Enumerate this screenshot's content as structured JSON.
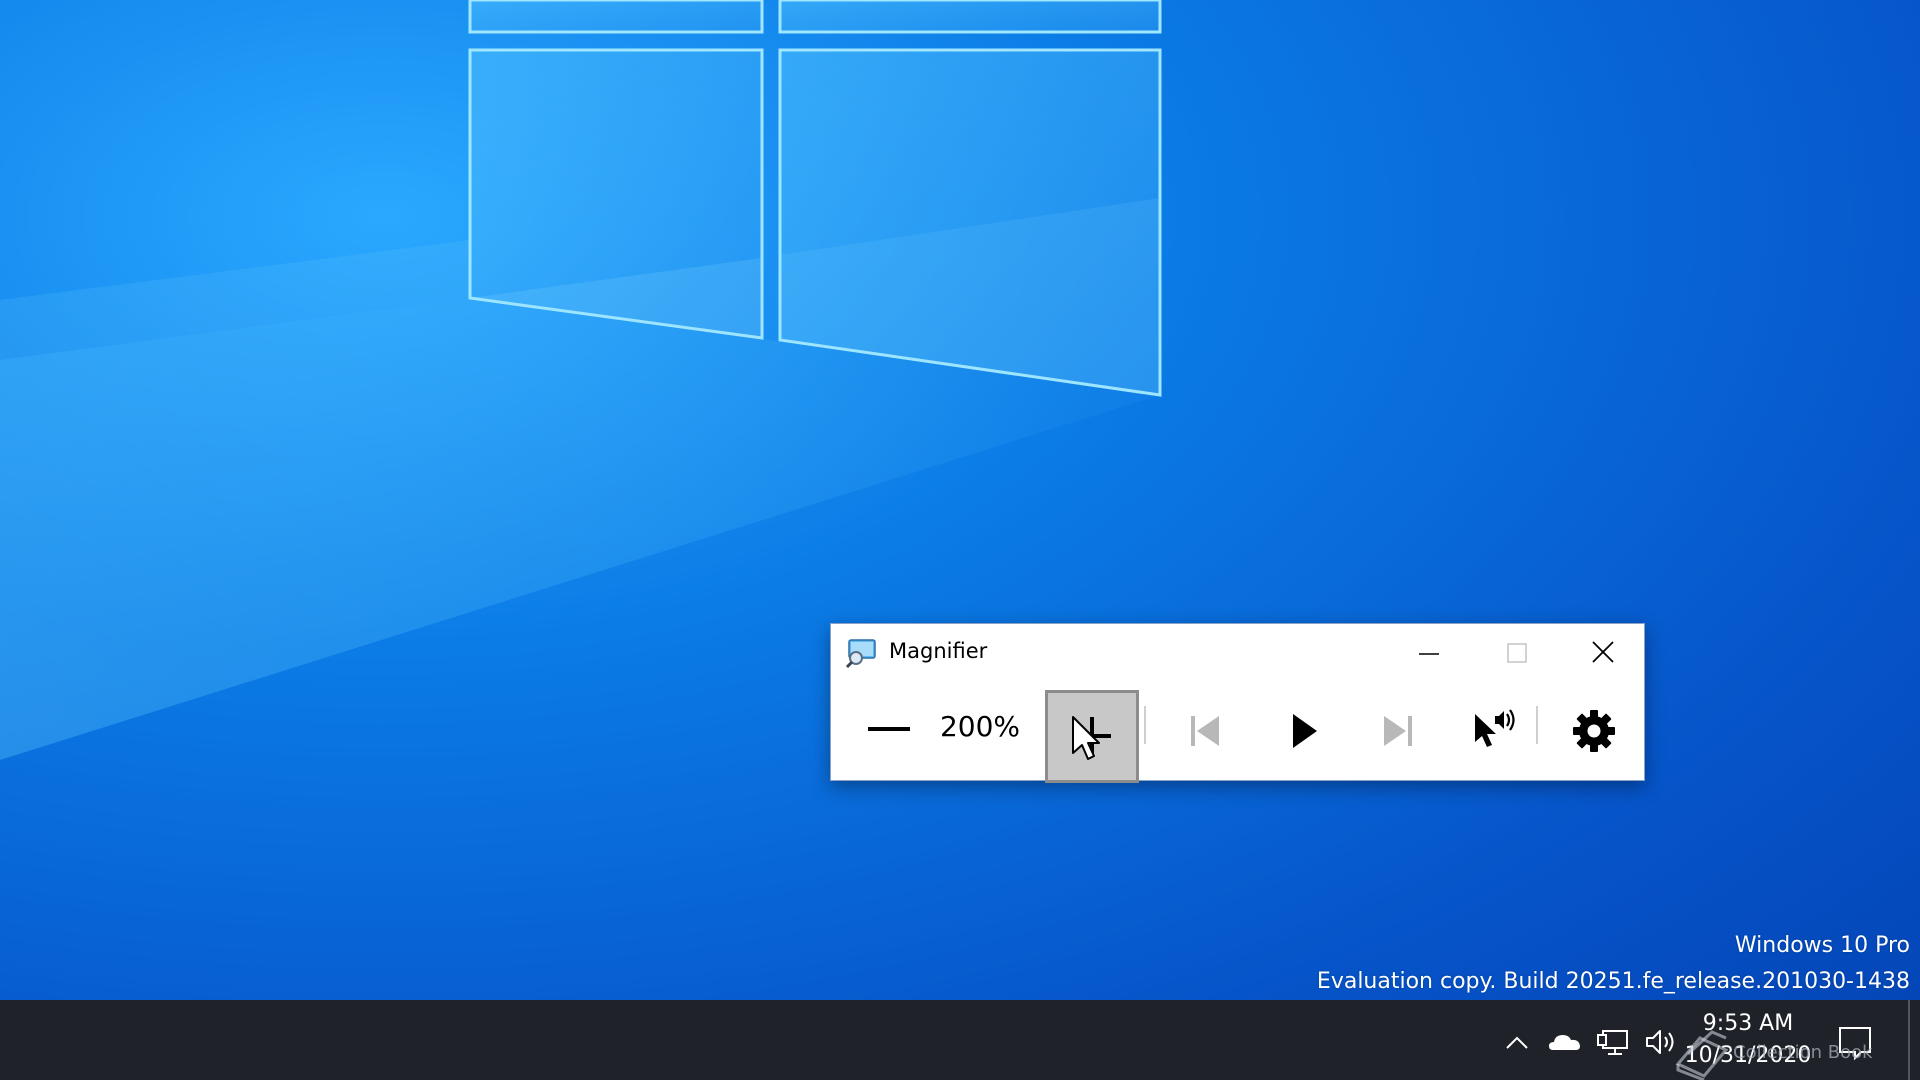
{
  "desktop": {
    "watermark_edition": "Windows 10 Pro",
    "watermark_build": "Evaluation copy. Build 20251.fe_release.201030-1438"
  },
  "magnifier": {
    "title": "Magnifier",
    "zoom_level": "200%",
    "icons": {
      "app": "magnifier-icon",
      "minimize": "minimize-icon",
      "maximize": "maximize-icon",
      "close": "close-icon",
      "zoom_out": "minus-icon",
      "zoom_in": "plus-icon",
      "previous": "previous-icon",
      "play": "play-icon",
      "next": "next-icon",
      "read_from_here": "pointer-speaker-icon",
      "settings": "gear-icon"
    }
  },
  "taskbar": {
    "time": "9:53 AM",
    "date": "10/31/2020",
    "overlay_text": "Collection Book",
    "icons": [
      "chevron-up-icon",
      "onedrive-icon",
      "network-icon",
      "volume-icon",
      "notification-icon"
    ]
  },
  "colors": {
    "taskbar_bg": "#1f2329",
    "desktop_blue": "#0b7ce6",
    "active_button_bg": "#c8c8c8"
  }
}
